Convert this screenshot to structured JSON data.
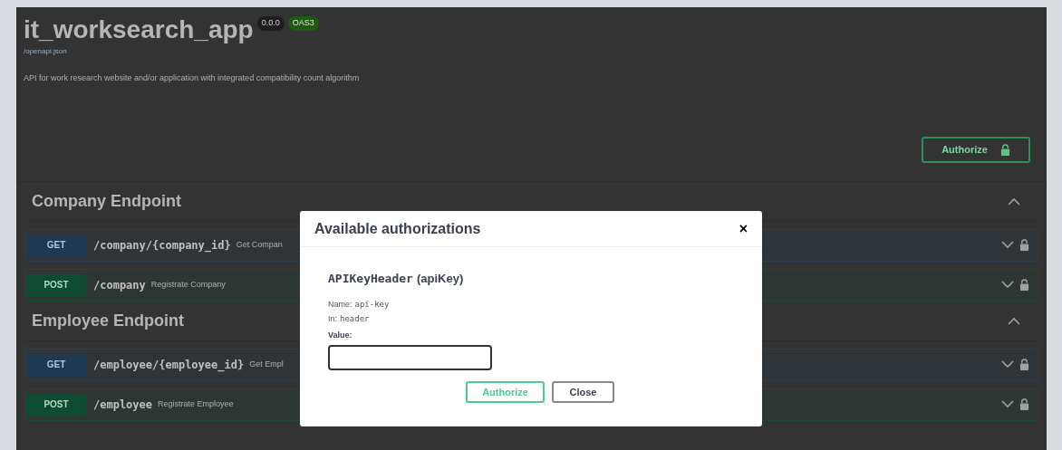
{
  "header": {
    "title": "it_worksearch_app",
    "badges": [
      {
        "label": "0.0.0",
        "kind": "version"
      },
      {
        "label": "OAS3",
        "kind": "spec"
      }
    ],
    "link": "/openapi.json",
    "description": "API for work research website and/or application with integrated compatibility count algorithm"
  },
  "authorize_button": {
    "label": "Authorize"
  },
  "sections": [
    {
      "title": "Company Endpoint",
      "expanded": true,
      "operations": [
        {
          "method": "GET",
          "path": "/company/{company_id}",
          "summary": "Get Compan"
        },
        {
          "method": "POST",
          "path": "/company",
          "summary": "Registrate Company"
        }
      ]
    },
    {
      "title": "Employee Endpoint",
      "expanded": true,
      "operations": [
        {
          "method": "GET",
          "path": "/employee/{employee_id}",
          "summary": "Get Empl"
        },
        {
          "method": "POST",
          "path": "/employee",
          "summary": "Registrate Employee"
        }
      ]
    }
  ],
  "dialog": {
    "title": "Available authorizations",
    "close": "×",
    "scheme": {
      "name": "APIKeyHeader",
      "type": "(apiKey)",
      "name_label": "Name:",
      "name_value": "api-key",
      "in_label": "In:",
      "in_value": "header",
      "value_label": "Value:"
    },
    "buttons": [
      {
        "label": "Authorize",
        "kind": "primary"
      },
      {
        "label": "Close",
        "kind": "secondary"
      }
    ]
  }
}
